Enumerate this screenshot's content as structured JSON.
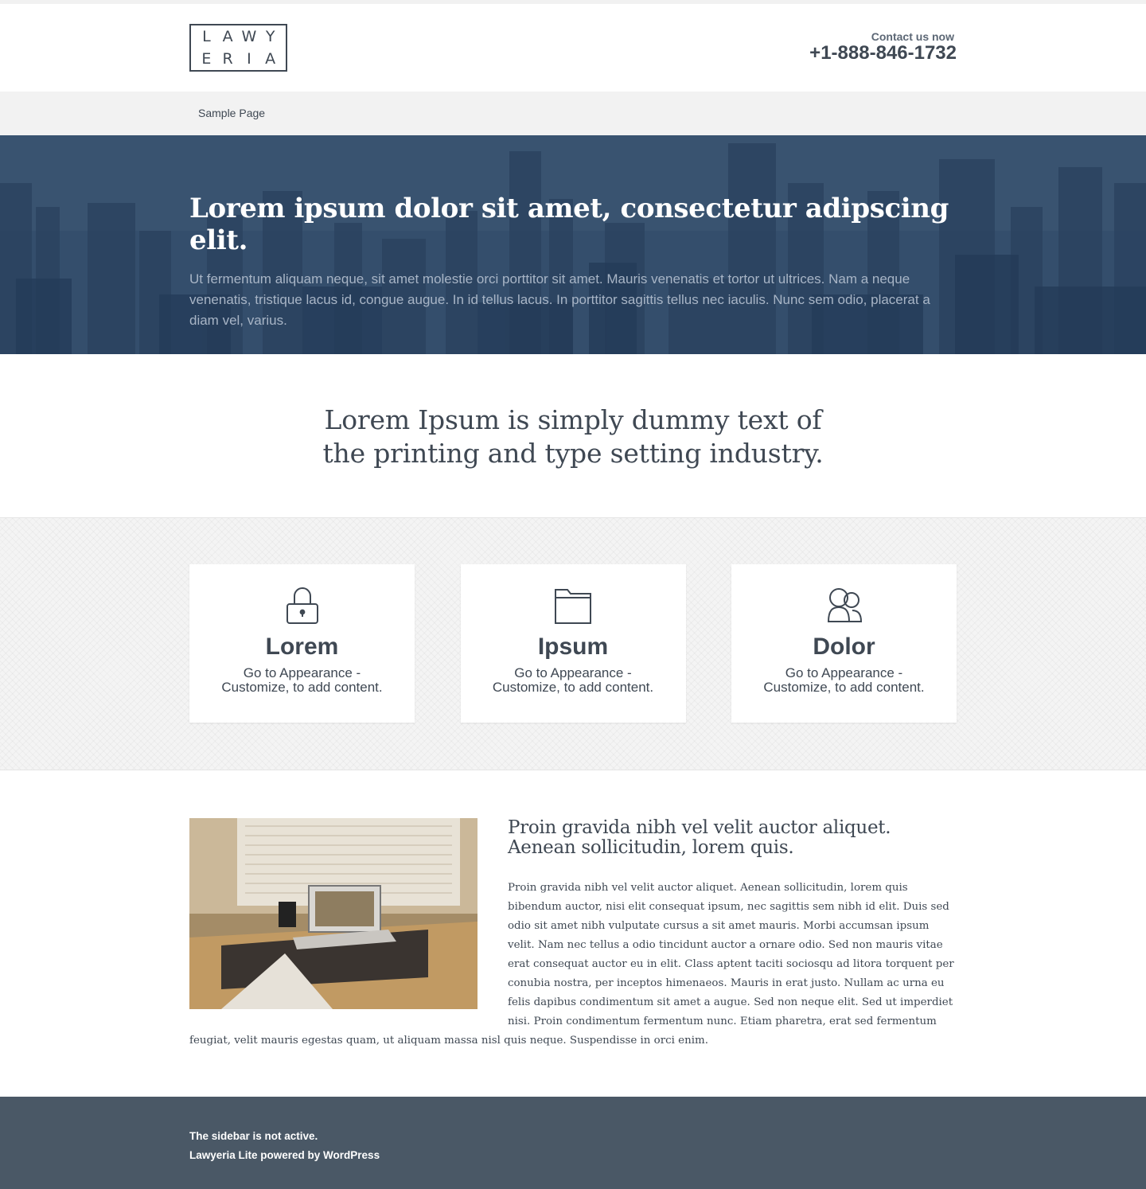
{
  "header": {
    "logo_letters": [
      "L",
      "A",
      "W",
      "Y",
      "E",
      "R",
      "I",
      "A"
    ],
    "contact_label": "Contact us now",
    "contact_phone": "+1-888-846-1732"
  },
  "nav": {
    "items": [
      {
        "label": "Sample Page"
      }
    ]
  },
  "hero": {
    "title": "Lorem ipsum dolor sit amet, consectetur adipscing elit.",
    "text": "Ut fermentum aliquam neque, sit amet molestie orci porttitor sit amet. Mauris venenatis et tortor ut ultrices. Nam a neque venenatis, tristique lacus id, congue augue. In id tellus lacus. In porttitor sagittis tellus nec iaculis. Nunc sem odio, placerat a diam vel, varius."
  },
  "intro": {
    "text": "Lorem Ipsum is simply dummy text of the printing and type setting industry."
  },
  "features": [
    {
      "icon": "lock-icon",
      "title": "Lorem",
      "text": "Go to Appearance - Customize, to add content."
    },
    {
      "icon": "folder-icon",
      "title": "Ipsum",
      "text": "Go to Appearance - Customize, to add content."
    },
    {
      "icon": "users-icon",
      "title": "Dolor",
      "text": "Go to Appearance - Customize, to add content."
    }
  ],
  "about": {
    "title": "Proin gravida nibh vel velit auctor aliquet. Aenean sollicitudin, lorem quis.",
    "body": "Proin gravida nibh vel velit auctor aliquet. Aenean sollicitudin, lorem quis bibendum auctor, nisi elit consequat ipsum, nec sagittis sem nibh id elit. Duis sed odio sit amet nibh vulputate cursus a sit amet mauris. Morbi accumsan ipsum velit. Nam nec tellus a odio tincidunt auctor a ornare odio. Sed non mauris vitae erat consequat auctor eu in elit. Class aptent taciti sociosqu ad litora torquent per conubia nostra, per inceptos himenaeos. Mauris in erat justo. Nullam ac urna eu felis dapibus condimentum sit amet a augue. Sed non neque elit. Sed ut imperdiet nisi. Proin condimentum fermentum nunc. Etiam pharetra, erat sed fermentum feugiat, velit mauris egestas quam, ut aliquam massa nisl quis neque. Suspendisse in orci enim."
  },
  "footer": {
    "sidebar_notice": "The sidebar is not active.",
    "credit": "Lawyeria Lite powered by WordPress"
  },
  "colors": {
    "text": "#3f4853",
    "nav_bg": "#f2f2f2",
    "hero_bg": "#2f4764",
    "footer_bg": "#4a5866"
  }
}
